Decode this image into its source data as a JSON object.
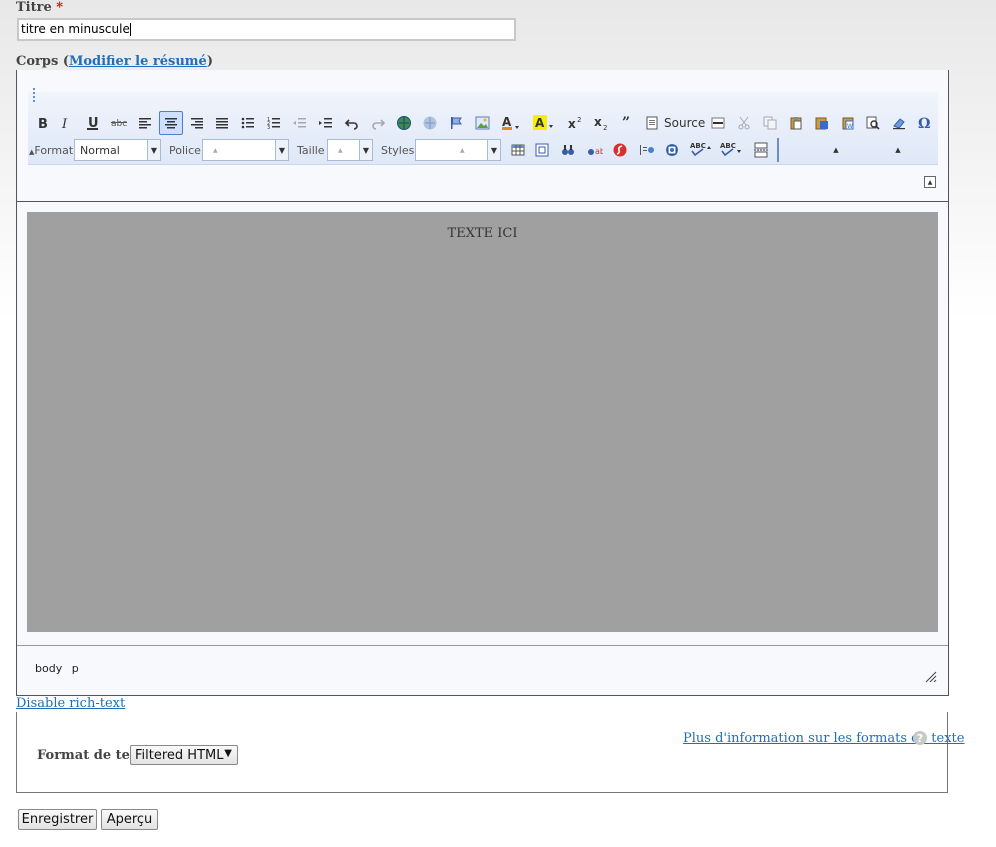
{
  "form": {
    "title_label": "Titre",
    "required_mark": "*",
    "title_value": "titre en minuscule",
    "body_label": "Corps",
    "body_paren_open": "(",
    "body_paren_close": ")",
    "edit_summary_link": "Modifier le résumé"
  },
  "toolbar": {
    "source_label": "Source",
    "format_label": "Format",
    "format_value": "Normal",
    "font_label": "Police",
    "size_label": "Taille",
    "styles_label": "Styles",
    "icons": [
      "bold-icon",
      "italic-icon",
      "underline-icon",
      "strikethrough-icon",
      "align-left-icon",
      "align-center-icon",
      "align-right-icon",
      "align-justify-icon",
      "bullet-list-icon",
      "numbered-list-icon",
      "outdent-icon",
      "indent-icon",
      "undo-icon",
      "redo-icon",
      "link-icon",
      "unlink-icon",
      "anchor-icon",
      "image-icon",
      "text-color-icon",
      "bg-color-icon",
      "superscript-icon",
      "subscript-icon",
      "blockquote-icon",
      "source-icon",
      "horizontal-rule-icon",
      "cut-icon",
      "copy-icon",
      "paste-icon",
      "paste-text-icon",
      "paste-word-icon",
      "find-icon",
      "remove-format-icon",
      "special-char-icon",
      "table-icon",
      "maximize-icon",
      "find-replace-icon",
      "replace-icon",
      "flash-icon",
      "show-blocks-icon",
      "iframe-icon",
      "spellcheck-icon",
      "scayt-icon",
      "page-break-icon"
    ]
  },
  "editor": {
    "content_text": "TEXTE ICI",
    "path_items": [
      "body",
      "p"
    ],
    "content_bg": "#a0a0a0"
  },
  "links": {
    "disable_rich_text": "Disable rich-text",
    "more_info_formats": "Plus d'information sur les formats de texte"
  },
  "format": {
    "label": "Format de texte",
    "selected": "Filtered HTML"
  },
  "actions": {
    "save": "Enregistrer",
    "preview": "Aperçu"
  },
  "colors": {
    "link": "#1f6dbb",
    "required": "#ee0000",
    "toolbar_blue": "#3a5da8"
  }
}
